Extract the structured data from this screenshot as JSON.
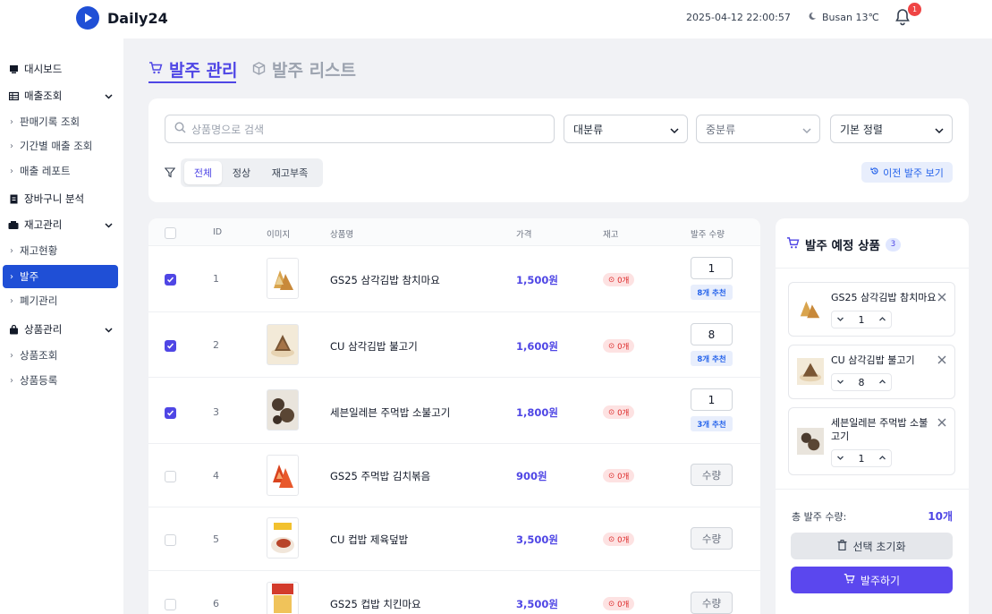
{
  "app": {
    "name": "Daily24",
    "datetime": "2025-04-12 22:00:57",
    "weather": "Busan 13℃",
    "notification_count": "1"
  },
  "sidebar": {
    "items": [
      {
        "label": "대시보드",
        "icon": "dashboard-icon"
      },
      {
        "label": "매출조회",
        "icon": "table-icon"
      },
      {
        "label": "판매기록 조회"
      },
      {
        "label": "기간별 매출 조회"
      },
      {
        "label": "매출 레포트"
      },
      {
        "label": "장바구니 분석",
        "icon": "receipt-icon"
      },
      {
        "label": "재고관리",
        "icon": "inventory-icon"
      },
      {
        "label": "재고현황"
      },
      {
        "label": "발주"
      },
      {
        "label": "폐기관리"
      },
      {
        "label": "상품관리",
        "icon": "bag-icon"
      },
      {
        "label": "상품조회"
      },
      {
        "label": "상품등록"
      }
    ]
  },
  "tabs": [
    {
      "label": "발주 관리"
    },
    {
      "label": "발주 리스트"
    }
  ],
  "filters": {
    "search_placeholder": "상품명으로 검색",
    "category_major": "대분류",
    "category_minor": "중분류",
    "sort": "기본 정렬",
    "segments": [
      "전체",
      "정상",
      "재고부족"
    ],
    "prev_orders": "이전 발주 보기"
  },
  "table": {
    "headers": [
      "ID",
      "이미지",
      "상품명",
      "가격",
      "재고",
      "발주 수량"
    ],
    "rows": [
      {
        "id": "1",
        "name": "GS25 삼각김밥 참치마요",
        "price": "1,500원",
        "stock": "0개",
        "qty": "1",
        "rec": "8개 추천",
        "checked": true
      },
      {
        "id": "2",
        "name": "CU 삼각김밥 불고기",
        "price": "1,600원",
        "stock": "0개",
        "qty": "8",
        "rec": "8개 추천",
        "checked": true
      },
      {
        "id": "3",
        "name": "세븐일레븐 주먹밥 소불고기",
        "price": "1,800원",
        "stock": "0개",
        "qty": "1",
        "rec": "3개 추천",
        "checked": true
      },
      {
        "id": "4",
        "name": "GS25 주먹밥 김치볶음",
        "price": "900원",
        "stock": "0개",
        "qty_placeholder": "수량",
        "checked": false
      },
      {
        "id": "5",
        "name": "CU 컵밥 제육덮밥",
        "price": "3,500원",
        "stock": "0개",
        "qty_placeholder": "수량",
        "checked": false
      },
      {
        "id": "6",
        "name": "GS25 컵밥 치킨마요",
        "price": "3,500원",
        "stock": "0개",
        "qty_placeholder": "수량",
        "checked": false
      }
    ]
  },
  "order_panel": {
    "title": "발주 예정 상품",
    "count": "3",
    "items": [
      {
        "name": "GS25 삼각김밥 참치마요",
        "qty": "1"
      },
      {
        "name": "CU 삼각김밥 불고기",
        "qty": "8"
      },
      {
        "name": "세븐일레븐 주먹밥 소불고기",
        "qty": "1"
      }
    ],
    "total_label": "총 발주 수량:",
    "total_value": "10개",
    "reset_label": "선택 초기화",
    "order_label": "발주하기"
  },
  "colors": {
    "primary": "#4f46e5",
    "sidebar_active": "#1f4fd6",
    "order_button": "#5b47ee",
    "stock_badge": "#dc2626"
  }
}
